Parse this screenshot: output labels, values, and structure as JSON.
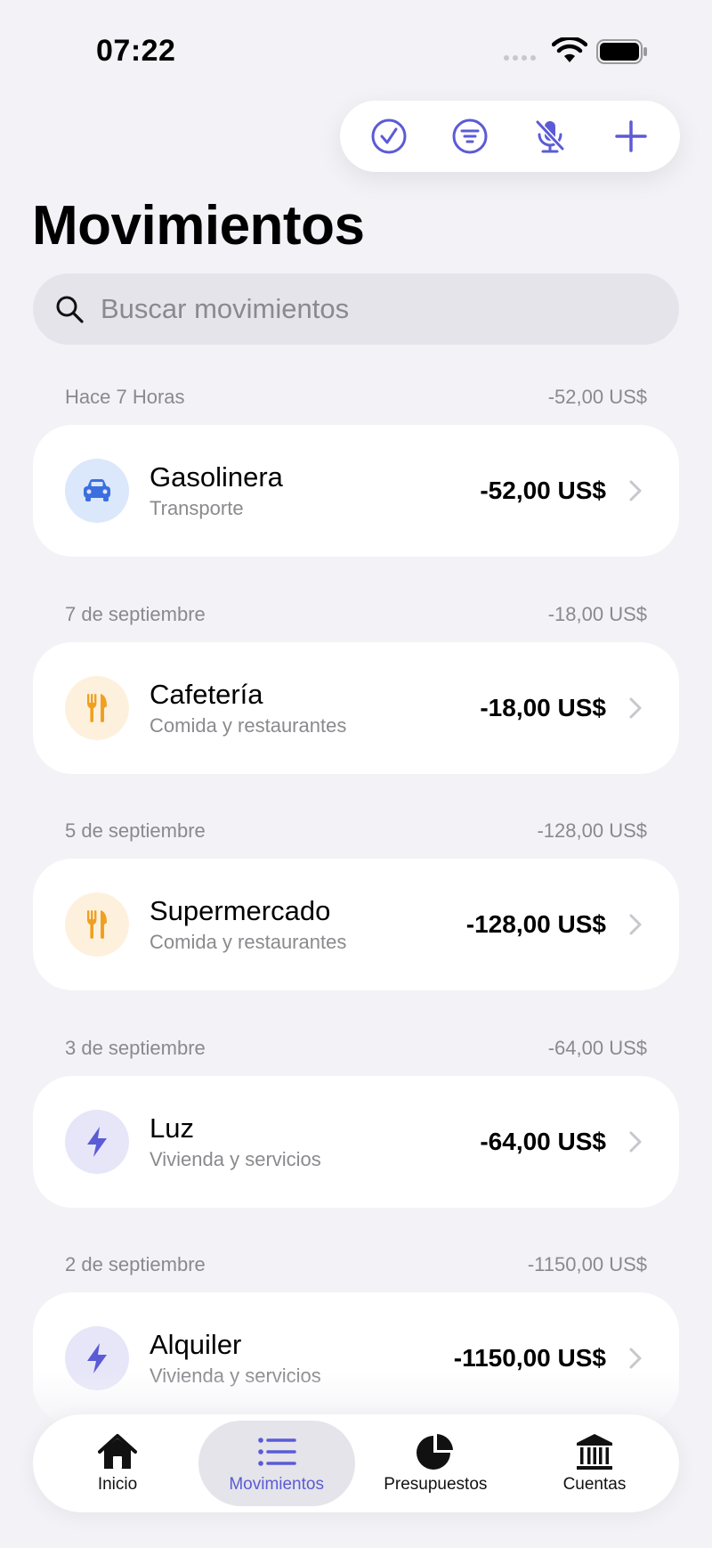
{
  "status_bar": {
    "time": "07:22"
  },
  "toolbar": {
    "buttons": [
      {
        "icon": "checkmark-circle-icon"
      },
      {
        "icon": "filter-icon"
      },
      {
        "icon": "mic-slash-icon"
      },
      {
        "icon": "plus-icon"
      }
    ]
  },
  "page": {
    "title": "Movimientos"
  },
  "search": {
    "placeholder": "Buscar movimientos",
    "value": ""
  },
  "colors": {
    "accent": "#5b5bd6",
    "background": "#f2f2f7"
  },
  "sections": [
    {
      "date": "Hace 7 Horas",
      "total": "-52,00 US$",
      "item": {
        "name": "Gasolinera",
        "category": "Transporte",
        "amount": "-52,00 US$",
        "icon": "car-icon",
        "icon_color": "#3b6fe0",
        "icon_bg": "#dbe7fb"
      }
    },
    {
      "date": "7 de septiembre",
      "total": "-18,00 US$",
      "item": {
        "name": "Cafetería",
        "category": "Comida y restaurantes",
        "amount": "-18,00 US$",
        "icon": "fork-knife-icon",
        "icon_color": "#f0a020",
        "icon_bg": "#fdf1dd"
      }
    },
    {
      "date": "5 de septiembre",
      "total": "-128,00 US$",
      "item": {
        "name": "Supermercado",
        "category": "Comida y restaurantes",
        "amount": "-128,00 US$",
        "icon": "fork-knife-icon",
        "icon_color": "#f0a020",
        "icon_bg": "#fdf1dd"
      }
    },
    {
      "date": "3 de septiembre",
      "total": "-64,00 US$",
      "item": {
        "name": "Luz",
        "category": "Vivienda y servicios",
        "amount": "-64,00 US$",
        "icon": "bolt-icon",
        "icon_color": "#5b5bd6",
        "icon_bg": "#e6e6f8"
      }
    },
    {
      "date": "2 de septiembre",
      "total": "-1150,00 US$",
      "item": {
        "name": "Alquiler",
        "category": "Vivienda y servicios",
        "amount": "-1150,00 US$",
        "icon": "bolt-icon",
        "icon_color": "#5b5bd6",
        "icon_bg": "#e6e6f8"
      }
    }
  ],
  "tabbar": {
    "tabs": [
      {
        "label": "Inicio",
        "icon": "house-icon",
        "active": false
      },
      {
        "label": "Movimientos",
        "icon": "list-icon",
        "active": true
      },
      {
        "label": "Presupuestos",
        "icon": "pie-chart-icon",
        "active": false
      },
      {
        "label": "Cuentas",
        "icon": "bank-icon",
        "active": false
      }
    ]
  }
}
